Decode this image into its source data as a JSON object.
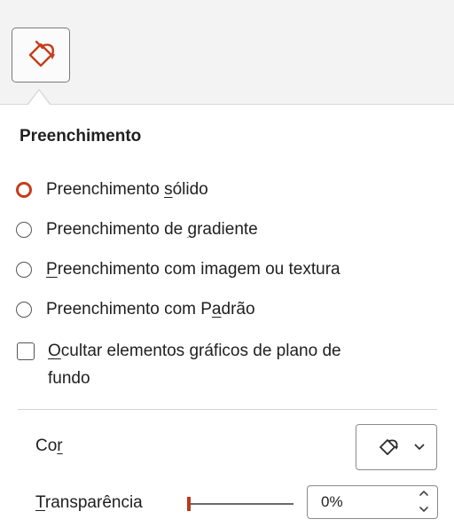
{
  "fill_panel": {
    "tab_icon": "paint-bucket-icon",
    "section_title": "Preenchimento",
    "fill_options": [
      {
        "pre": "Preenchimento ",
        "key": "s",
        "post": "ólido",
        "selected": true
      },
      {
        "pre": "Preenchimento de ",
        "key": "g",
        "post": "radiente",
        "selected": false
      },
      {
        "pre": "",
        "key": "P",
        "post": "reenchimento com imagem ou textura",
        "selected": false
      },
      {
        "pre": "Preenchimento com P",
        "key": "a",
        "post": "drão",
        "selected": false
      }
    ],
    "hide_background": {
      "key": "O",
      "line1_rest": "cultar elementos gráficos de plano de",
      "line2": "fundo",
      "checked": false
    },
    "color": {
      "pre": "Co",
      "key": "r",
      "icon": "paint-bucket-icon",
      "dropdown_icon": "chevron-down-icon"
    },
    "transparency": {
      "key": "T",
      "rest": "ransparência",
      "value_text": "0%",
      "value_fraction": 0
    }
  },
  "colors": {
    "accent": "#c43e1c",
    "panel_bg": "#ffffff",
    "chrome_bg": "#f3f3f3"
  }
}
